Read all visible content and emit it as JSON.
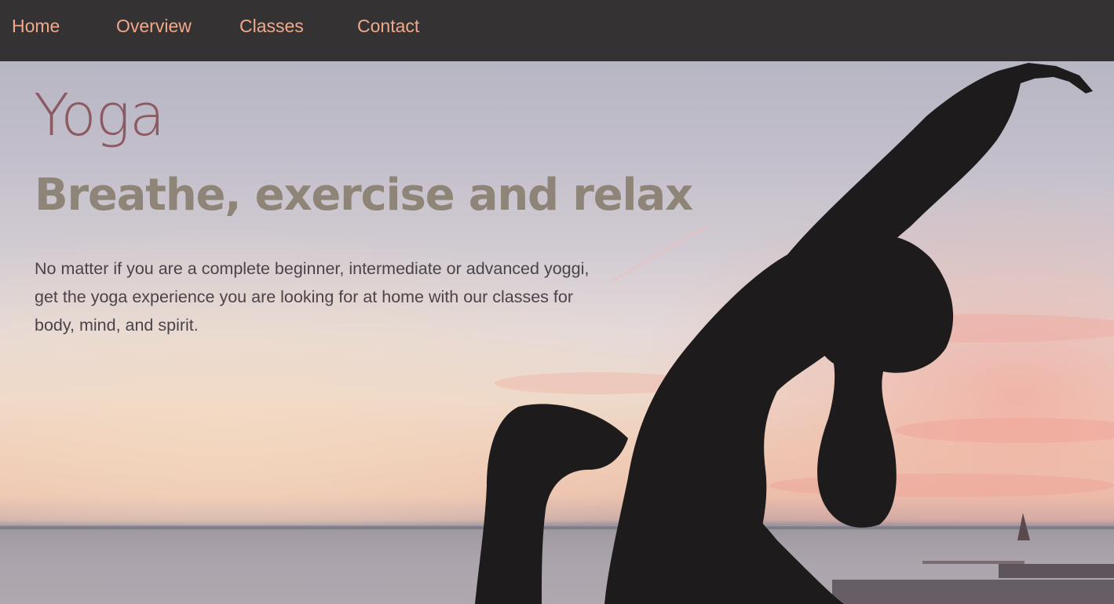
{
  "nav": {
    "items": [
      {
        "label": "Home"
      },
      {
        "label": "Overview"
      },
      {
        "label": "Classes"
      },
      {
        "label": "Contact"
      }
    ]
  },
  "hero": {
    "title": "Yoga",
    "subtitle": "Breathe, exercise and relax",
    "description": "No matter if you are a complete beginner, intermediate or advanced yoggi, get the yoga experience you are looking for at home with our classes for body, mind, and spirit.",
    "image_subject": "yoga-silhouette-at-sunset"
  },
  "colors": {
    "nav_background": "#343233",
    "nav_link": "#f0a98a",
    "title": "#8c5a62",
    "subtitle": "#8e8477",
    "body_text": "#4a4349",
    "silhouette": "#1e1b1d"
  }
}
